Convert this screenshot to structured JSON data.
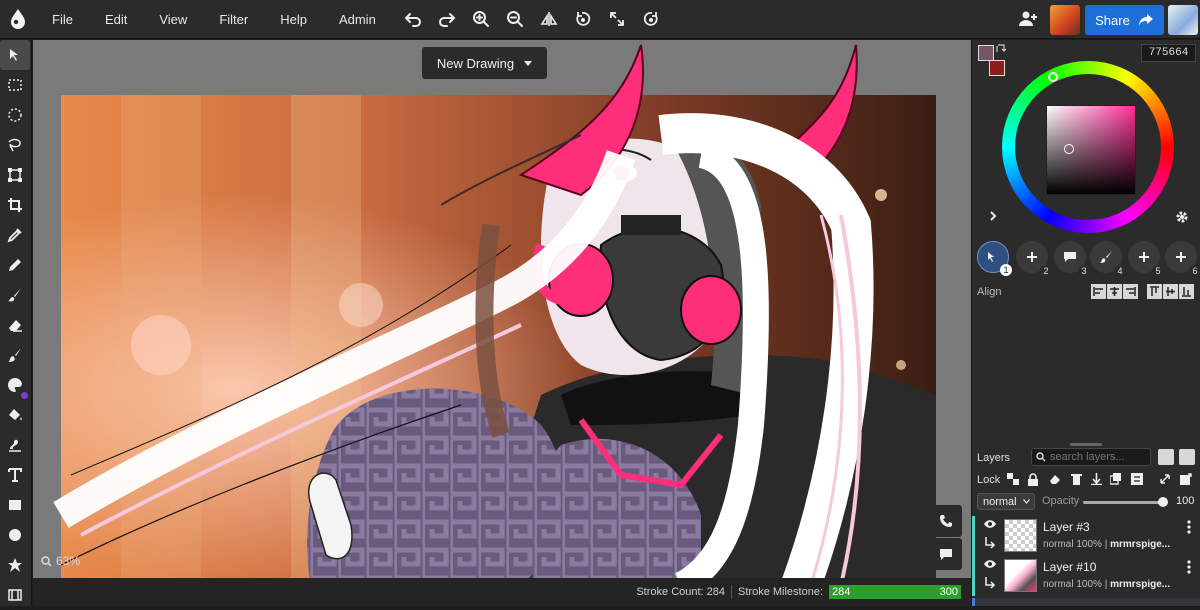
{
  "menu": {
    "items": [
      {
        "label": "File"
      },
      {
        "label": "Edit"
      },
      {
        "label": "View"
      },
      {
        "label": "Filter"
      },
      {
        "label": "Help"
      },
      {
        "label": "Admin"
      }
    ],
    "icons": [
      "undo-icon",
      "redo-icon",
      "zoom-in-icon",
      "zoom-out-icon",
      "flip-icon",
      "rotate-icon",
      "fullscreen-icon",
      "reset-rotate-icon"
    ]
  },
  "header": {
    "share_label": "Share"
  },
  "canvas": {
    "title_button": "New Drawing",
    "zoom": "63%"
  },
  "status": {
    "stroke_count_label": "Stroke Count: 284",
    "stroke_milestone_label": "Stroke Milestone:",
    "milestone_current": "284",
    "milestone_target": "300",
    "milestone_progress": 0.947
  },
  "color": {
    "hex": "775664",
    "primary": "#775664",
    "secondary": "#8b1c1c"
  },
  "brush_slots": [
    {
      "num": "1",
      "icon": "brush-select-icon"
    },
    {
      "num": "2",
      "icon": "plus-icon"
    },
    {
      "num": "3",
      "icon": "speech-bubble-icon"
    },
    {
      "num": "4",
      "icon": "brush-icon"
    },
    {
      "num": "5",
      "icon": "plus-icon"
    },
    {
      "num": "6",
      "icon": "plus-icon"
    }
  ],
  "align": {
    "label": "Align"
  },
  "layers": {
    "title": "Layers",
    "search_placeholder": "search layers...",
    "lock_label": "Lock",
    "blend_mode": "normal",
    "opacity_label": "Opacity",
    "opacity_value": "100",
    "opacity_fraction": 1.0,
    "items": [
      {
        "name": "Layer #3",
        "mode": "normal",
        "opacity": "100%",
        "author": "mrmrspige..."
      },
      {
        "name": "Layer #10",
        "mode": "normal",
        "opacity": "100%",
        "author": "mrmrspige..."
      }
    ]
  }
}
